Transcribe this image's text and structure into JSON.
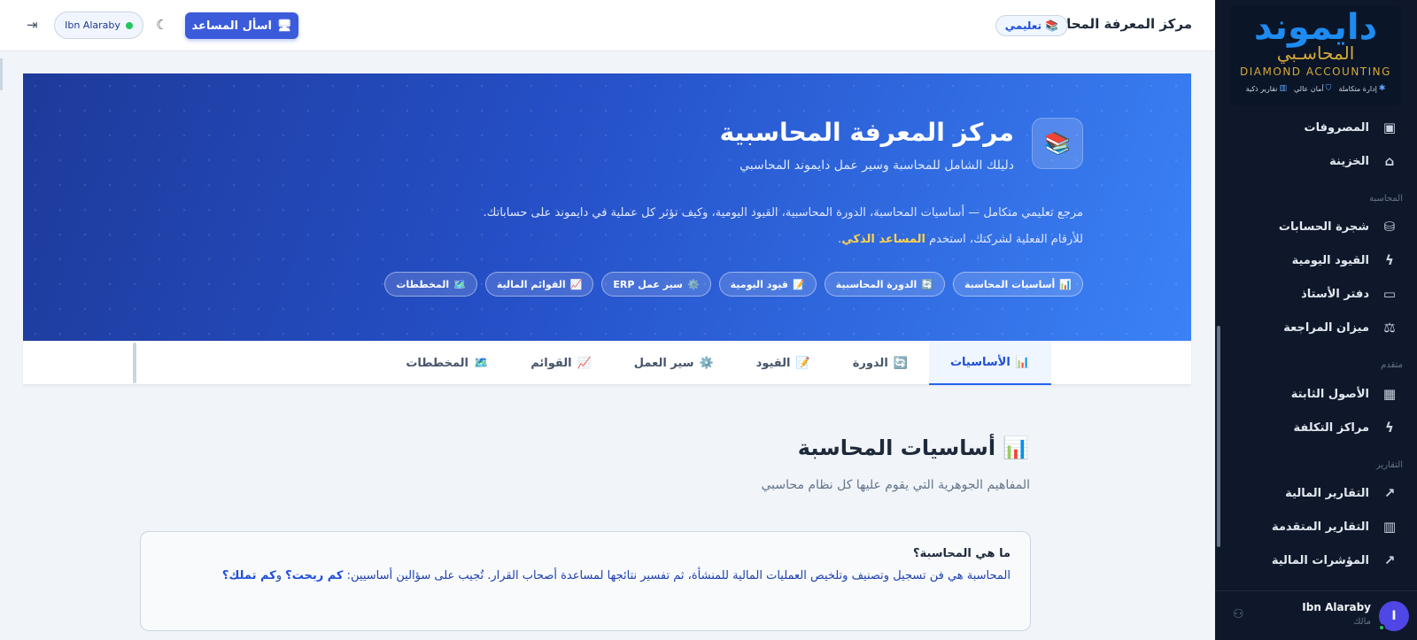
{
  "sidebar": {
    "logo": {
      "main": "دايموند",
      "sub": "المحاسـبي",
      "en": "DIAMOND ACCOUNTING",
      "features": [
        "إدارة متكاملة",
        "أمان عالي",
        "تقارير ذكية"
      ]
    },
    "items_top": [
      {
        "label": "المصروفات",
        "icon": "wallet-icon"
      },
      {
        "label": "الخزينة",
        "icon": "bank-icon"
      }
    ],
    "section_accounting": "المحاسبة",
    "items_accounting": [
      {
        "label": "شجرة الحسابات",
        "icon": "database-icon"
      },
      {
        "label": "القيود اليومية",
        "icon": "bolt-icon"
      },
      {
        "label": "دفتر الأستاذ",
        "icon": "book-icon"
      },
      {
        "label": "ميزان المراجعة",
        "icon": "scale-icon"
      }
    ],
    "section_advanced": "متقدم",
    "items_advanced": [
      {
        "label": "الأصول الثابتة",
        "icon": "building-icon"
      },
      {
        "label": "مراكز التكلفة",
        "icon": "bolt-icon"
      }
    ],
    "section_reports": "التقارير",
    "items_reports": [
      {
        "label": "التقارير المالية",
        "icon": "trend-up-icon"
      },
      {
        "label": "التقارير المتقدمة",
        "icon": "bar-chart-icon"
      },
      {
        "label": "المؤشرات المالية",
        "icon": "trend-up-icon"
      }
    ],
    "footer": {
      "avatar_letter": "I",
      "user_name": "Ibn Alaraby",
      "user_role": "مالك"
    }
  },
  "header": {
    "title": "مركز المعرفة المحاسبية",
    "badge": "تعليمي",
    "ask_button": "اسأل المساعد",
    "user_pill": "Ibn Alaraby"
  },
  "hero": {
    "title": "مركز المعرفة المحاسبية",
    "subtitle": "دليلك الشامل للمحاسبة وسير عمل دايموند المحاسبي",
    "desc_before": "مرجع تعليمي متكامل — أساسيات المحاسبة، الدورة المحاسبية، القيود اليومية، وكيف تؤثر كل عملية في دايموند على حساباتك. للأرقام الفعلية لشركتك، استخدم ",
    "desc_highlight": "المساعد الذكي",
    "desc_after": ".",
    "chips": [
      {
        "icon": "📊",
        "label": "أساسيات المحاسبة"
      },
      {
        "icon": "🔄",
        "label": "الدورة المحاسبية"
      },
      {
        "icon": "📝",
        "label": "قيود اليومية"
      },
      {
        "icon": "⚙️",
        "label": "سير عمل ERP"
      },
      {
        "icon": "📈",
        "label": "القوائم المالية"
      },
      {
        "icon": "🗺️",
        "label": "المخططات"
      }
    ]
  },
  "tabs": [
    {
      "icon": "📊",
      "label": "الأساسيات",
      "active": true
    },
    {
      "icon": "🔄",
      "label": "الدورة",
      "active": false
    },
    {
      "icon": "📝",
      "label": "القيود",
      "active": false
    },
    {
      "icon": "⚙️",
      "label": "سير العمل",
      "active": false
    },
    {
      "icon": "📈",
      "label": "القوائم",
      "active": false
    },
    {
      "icon": "🗺️",
      "label": "المخططات",
      "active": false
    }
  ],
  "section": {
    "icon": "📊",
    "title": "أساسيات المحاسبة",
    "subtitle": "المفاهيم الجوهرية التي يقوم عليها كل نظام محاسبي",
    "card": {
      "question": "ما هي المحاسبة؟",
      "answer_text": "المحاسبة هي فن تسجيل وتصنيف وتلخيص العمليات المالية للمنشأة، ثم تفسير نتائجها لمساعدة أصحاب القرار. تُجيب على سؤالين أساسيين: ",
      "answer_q1": "كم ربحت؟",
      "answer_and": " و",
      "answer_q2": "كم تملك؟"
    }
  }
}
